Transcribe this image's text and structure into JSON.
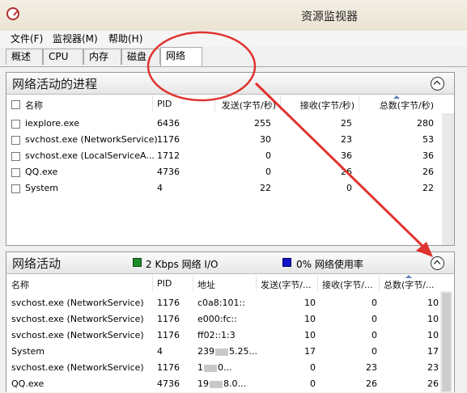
{
  "window": {
    "title": "资源监视器",
    "icon": "resource-monitor-icon"
  },
  "menu": [
    "文件(F)",
    "监视器(M)",
    "帮助(H)"
  ],
  "tabs": [
    "概述",
    "CPU",
    "内存",
    "磁盘",
    "网络"
  ],
  "active_tab": "网络",
  "processes": {
    "title": "网络活动的进程",
    "columns": [
      "名称",
      "PID",
      "发送(字节/秒)",
      "接收(字节/秒)",
      "总数(字节/秒)"
    ],
    "rows": [
      {
        "name": "iexplore.exe",
        "pid": "6436",
        "send": "255",
        "recv": "25",
        "total": "280"
      },
      {
        "name": "svchost.exe (NetworkService)",
        "pid": "1176",
        "send": "30",
        "recv": "23",
        "total": "53"
      },
      {
        "name": "svchost.exe (LocalServiceA...",
        "pid": "1712",
        "send": "0",
        "recv": "36",
        "total": "36"
      },
      {
        "name": "QQ.exe",
        "pid": "4736",
        "send": "0",
        "recv": "26",
        "total": "26"
      },
      {
        "name": "System",
        "pid": "4",
        "send": "22",
        "recv": "0",
        "total": "22"
      }
    ]
  },
  "network": {
    "title": "网络活动",
    "io_label": "2 Kbps 网络 I/O",
    "usage_label": "0% 网络使用率",
    "colors": {
      "io": "#1e8a2a",
      "usage": "#1414c8"
    },
    "columns": [
      "名称",
      "PID",
      "地址",
      "发送(字节/...",
      "接收(字节/...",
      "总数(字节/..."
    ],
    "rows": [
      {
        "name": "svchost.exe (NetworkService)",
        "pid": "1176",
        "addr_a": "c0a8:101::",
        "addr_b": "",
        "send": "10",
        "recv": "0",
        "total": "10"
      },
      {
        "name": "svchost.exe (NetworkService)",
        "pid": "1176",
        "addr_a": "e000:fc::",
        "addr_b": "",
        "send": "10",
        "recv": "0",
        "total": "10"
      },
      {
        "name": "svchost.exe (NetworkService)",
        "pid": "1176",
        "addr_a": "ff02::1:3",
        "addr_b": "",
        "send": "10",
        "recv": "0",
        "total": "10"
      },
      {
        "name": "System",
        "pid": "4",
        "addr_a": "239",
        "addr_b": "5.25...",
        "send": "17",
        "recv": "0",
        "total": "17"
      },
      {
        "name": "svchost.exe (NetworkService)",
        "pid": "1176",
        "addr_a": "1",
        "addr_b": "0...",
        "send": "0",
        "recv": "23",
        "total": "23"
      },
      {
        "name": "QQ.exe",
        "pid": "4736",
        "addr_a": "19",
        "addr_b": "8.0...",
        "send": "0",
        "recv": "26",
        "total": "26"
      }
    ]
  },
  "annotation": {
    "color": "#e0332f"
  }
}
